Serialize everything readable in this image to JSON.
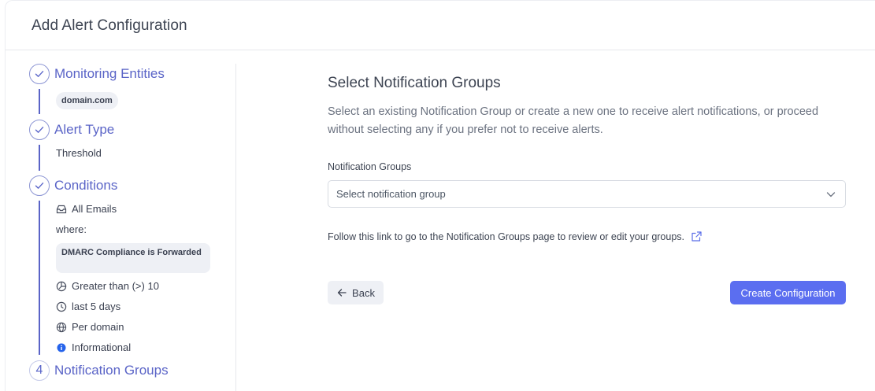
{
  "header": {
    "title": "Add Alert Configuration"
  },
  "steps": [
    {
      "label": "Monitoring Entities",
      "state": "done",
      "detail": "domain.com"
    },
    {
      "label": "Alert Type",
      "state": "done",
      "detail": "Threshold"
    },
    {
      "label": "Conditions",
      "state": "done"
    },
    {
      "number": "4",
      "label": "Notification Groups",
      "state": "current"
    }
  ],
  "conditions": {
    "scope": {
      "icon": "inbox-icon",
      "text": "All Emails"
    },
    "where_label": "where:",
    "filter": "DMARC Compliance is Forwarded",
    "threshold": {
      "icon": "gauge-icon",
      "text": "Greater than (>) 10"
    },
    "period": {
      "icon": "clock-icon",
      "text": "last 5 days"
    },
    "grouping": {
      "icon": "globe-icon",
      "text": "Per domain"
    },
    "severity": {
      "icon": "info-icon",
      "text": "Informational",
      "color": "#2563eb"
    }
  },
  "main": {
    "title": "Select Notification Groups",
    "description": "Select an existing Notification Group or create a new one to receive alert notifications, or proceed without selecting any if you prefer not to receive alerts.",
    "field_label": "Notification Groups",
    "select_placeholder": "Select notification group",
    "link_text": "Follow this link to go to the Notification Groups page to review or edit your groups.",
    "back_label": "Back",
    "create_label": "Create Configuration"
  },
  "colors": {
    "accent": "#5b6ef0",
    "step": "#5a64c7"
  }
}
